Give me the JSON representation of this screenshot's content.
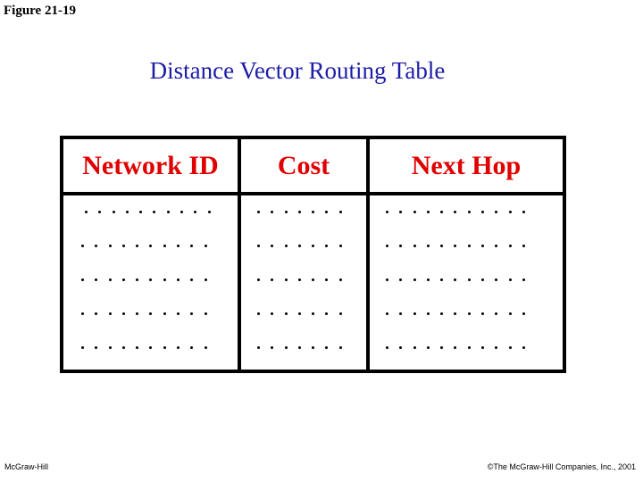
{
  "figure_label": "Figure 21-19",
  "title": "Distance Vector Routing Table",
  "table": {
    "headers": [
      "Network ID",
      "Cost",
      "Next Hop"
    ],
    "row_count": 5,
    "placeholder_dots_per_column": [
      10,
      7,
      11
    ]
  },
  "footer": {
    "left": "McGraw-Hill",
    "right": "©The McGraw-Hill Companies, Inc., 2001"
  },
  "colors": {
    "title": "#1c1ca8",
    "header_text": "#e00000",
    "border": "#000000"
  }
}
